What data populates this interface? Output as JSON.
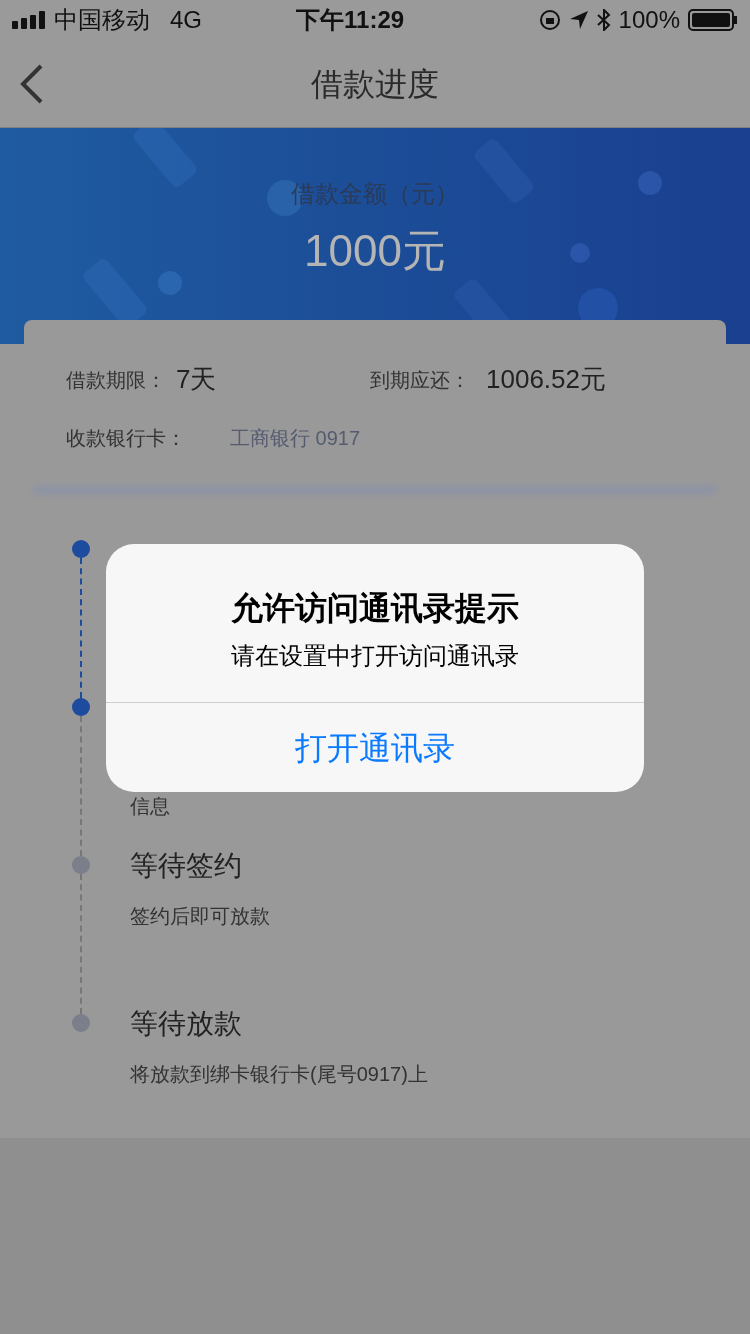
{
  "status_bar": {
    "carrier": "中国移动",
    "network": "4G",
    "time": "下午11:29",
    "battery": "100%"
  },
  "nav": {
    "title": "借款进度"
  },
  "banner": {
    "label": "借款金额（元）",
    "amount": "1000元"
  },
  "summary": {
    "term_label": "借款期限：",
    "term": "7天",
    "due_label": "到期应还：",
    "due": "1006.52元",
    "card_label": "收款银行卡：",
    "card": "工商银行 0917"
  },
  "steps": [
    {
      "done": true
    },
    {
      "note": "信息",
      "done": true
    },
    {
      "title": "等待签约",
      "note": "签约后即可放款",
      "done": false
    },
    {
      "title": "等待放款",
      "note": "将放款到绑卡银行卡(尾号0917)上",
      "done": false
    }
  ],
  "dialog": {
    "title": "允许访问通讯录提示",
    "message": "请在设置中打开访问通讯录",
    "button": "打开通讯录"
  }
}
